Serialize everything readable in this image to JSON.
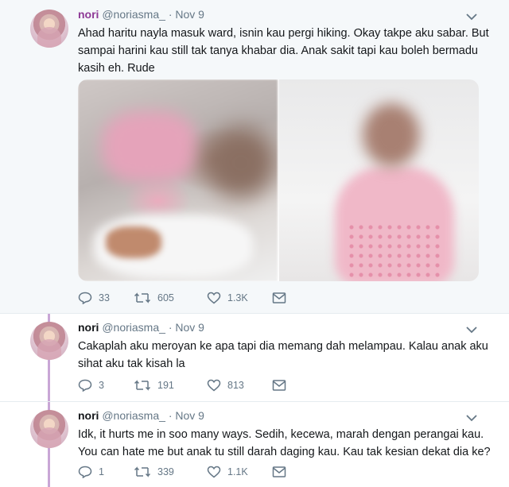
{
  "tweets": [
    {
      "name": "nori",
      "handle": "@noriasma_",
      "separator": "·",
      "time": "Nov 9",
      "text": "Ahad haritu nayla masuk ward, isnin kau pergi hiking. Okay takpe aku sabar. But sampai harini kau still tak tanya khabar dia. Anak sakit tapi kau boleh bermadu kasih eh. Rude",
      "replies": "33",
      "retweets": "605",
      "likes": "1.3K"
    },
    {
      "name": "nori",
      "handle": "@noriasma_",
      "separator": "·",
      "time": "Nov 9",
      "text": "Cakaplah aku meroyan ke apa tapi dia memang dah melampau. Kalau anak aku sihat aku tak kisah la",
      "replies": "3",
      "retweets": "191",
      "likes": "813"
    },
    {
      "name": "nori",
      "handle": "@noriasma_",
      "separator": "·",
      "time": "Nov 9",
      "text": "Idk, it hurts me in soo many ways. Sedih, kecewa, marah dengan perangai kau. You can hate me but anak tu still darah daging kau. Kau tak kesian dekat dia ke?",
      "replies": "1",
      "retweets": "339",
      "likes": "1.1K"
    }
  ],
  "colors": {
    "thread_line": "#c9a6d6",
    "name_highlight": "#8e3a96",
    "secondary_text": "#657786",
    "highlight_bg": "#f5f8fa"
  },
  "icons": [
    "avatar",
    "chevron-down-icon",
    "reply-icon",
    "retweet-icon",
    "like-icon",
    "direct-message-icon"
  ]
}
